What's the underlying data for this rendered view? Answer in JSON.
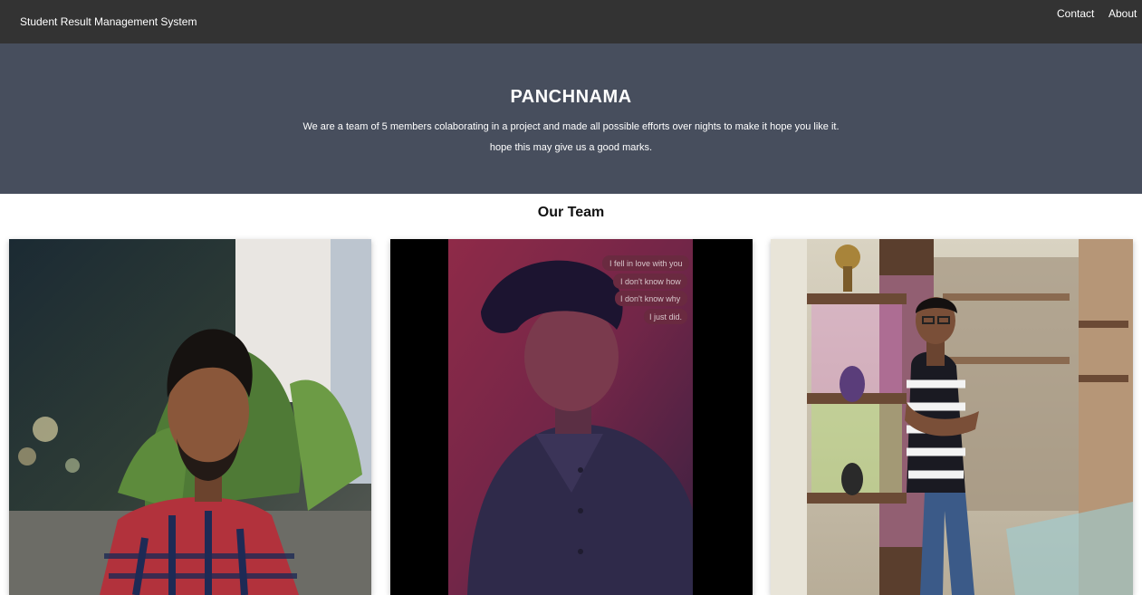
{
  "navbar": {
    "brand": "Student Result Management System",
    "links": [
      "Contact",
      "About"
    ]
  },
  "hero": {
    "title": "PANCHNAMA",
    "line1": "We are a team of 5 members colaborating in a project and made all possible efforts over nights to make it hope you like it.",
    "line2": "hope this may give us a good marks."
  },
  "team": {
    "heading": "Our Team",
    "photo2_chat": [
      "I fell in love with you",
      "I don't know how",
      "I don't know why",
      "I just did."
    ]
  },
  "colors": {
    "navbar_bg": "#333333",
    "hero_bg": "#474e5d"
  }
}
